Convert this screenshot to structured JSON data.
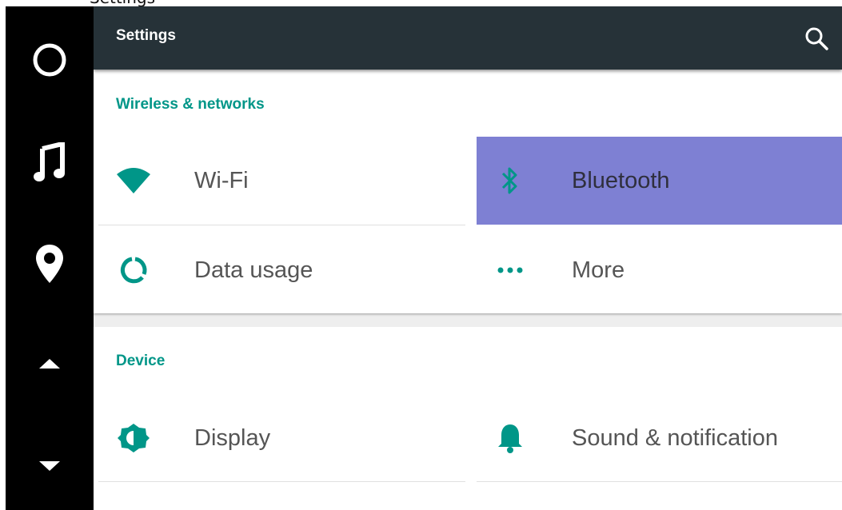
{
  "app_title": "Settings",
  "nav_rail": {
    "items": [
      {
        "icon": "home-circle-icon"
      },
      {
        "icon": "music-note-icon"
      },
      {
        "icon": "location-pin-icon"
      },
      {
        "icon": "arrow-up-icon"
      },
      {
        "icon": "arrow-down-icon"
      }
    ]
  },
  "header": {
    "title": "Settings",
    "search_icon": "search-icon"
  },
  "sections": {
    "wireless": {
      "title": "Wireless & networks",
      "tiles": {
        "wifi": {
          "label": "Wi-Fi",
          "icon": "wifi-icon"
        },
        "bluetooth": {
          "label": "Bluetooth",
          "icon": "bluetooth-icon",
          "selected": true
        },
        "data_usage": {
          "label": "Data usage",
          "icon": "data-usage-icon"
        },
        "more": {
          "label": "More",
          "icon": "more-dots-icon"
        }
      }
    },
    "device": {
      "title": "Device",
      "tiles": {
        "display": {
          "label": "Display",
          "icon": "brightness-icon"
        },
        "sound": {
          "label": "Sound & notification",
          "icon": "bell-icon"
        }
      }
    }
  },
  "colors": {
    "accent": "#009688",
    "app_bar": "#263238",
    "selected_tile": "#7e80d3",
    "nav_rail": "#000000"
  }
}
